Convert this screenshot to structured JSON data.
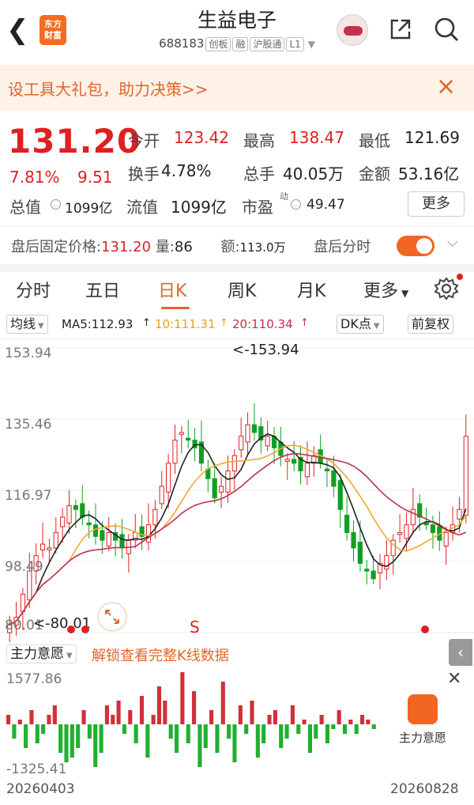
{
  "header": {
    "title": "生益电子",
    "code": "688183",
    "tags": [
      "创板",
      "融",
      "沪股通",
      "L1"
    ],
    "logo_text": "东方财富"
  },
  "banner": {
    "text": "设工具大礼包，助力决策>>",
    "close": "×"
  },
  "quote": {
    "price": "131.20",
    "change_pct": "7.81%",
    "change_amt": "9.51",
    "open_label": "今开",
    "open": "123.42",
    "high_label": "最高",
    "high": "138.47",
    "low_label": "最低",
    "low": "121.69",
    "turnover_label": "换手",
    "turnover": "4.78%",
    "volume_label": "总手",
    "volume": "40.05万",
    "amount_label": "金额",
    "amount": "53.16亿",
    "mcap_label": "总值",
    "mcap": "1099亿",
    "float_label": "流值",
    "float_cap": "1099亿",
    "pe_label": "市盈",
    "pe_super": "动",
    "pe": "49.47",
    "more_button": "更多"
  },
  "after_hours": {
    "price_label": "盘后固定价格:",
    "price": "131.20",
    "vol_label": "量:",
    "vol": "86",
    "amount_label": "额:",
    "amount": "113.0万",
    "timeshare_label": "盘后分时"
  },
  "tabs": [
    "分时",
    "五日",
    "日K",
    "周K",
    "月K",
    "更多"
  ],
  "active_tab": 2,
  "ma_row": {
    "type_chip": "均线",
    "ma5": "MA5:112.93",
    "ma10": "10:111.31",
    "ma20": "20:110.34",
    "dk_chip": "DK点",
    "adj_chip": "前复权"
  },
  "colors": {
    "up": "#e02020",
    "down": "#10a020",
    "ma5": "#222222",
    "ma10": "#f0a830",
    "ma20": "#c0304a",
    "accent": "#e2652a"
  },
  "chart_data": {
    "type": "candlestick",
    "y_ticks": [
      "153.94",
      "135.46",
      "116.97",
      "98.49",
      "80.01"
    ],
    "ylim": [
      80.01,
      153.94
    ],
    "annotations": {
      "max": "<-153.94",
      "min": "<-80.01",
      "signal": "S"
    },
    "closes": [
      82,
      84,
      90,
      96,
      100,
      103,
      102,
      106,
      110,
      113,
      112,
      110,
      108,
      105,
      104,
      106,
      104,
      102,
      104,
      106,
      105,
      108,
      112,
      118,
      124,
      130,
      132,
      130,
      128,
      124,
      120,
      115,
      118,
      122,
      126,
      131,
      134,
      132,
      130,
      131,
      128,
      126,
      125,
      124,
      122,
      124,
      126,
      124,
      122,
      118,
      112,
      106,
      102,
      98,
      96,
      94,
      98,
      100,
      104,
      106,
      108,
      112,
      110,
      108,
      106,
      104,
      106,
      108,
      112,
      131
    ]
  },
  "indicator": {
    "name": "主力意愿",
    "unlock_text": "解锁查看完整K线数据",
    "max_label": "1577.86",
    "min_label": "-1325.41",
    "card_label": "主力意愿",
    "bars": [
      2,
      -3,
      1,
      -5,
      3,
      -4,
      -2,
      2,
      4,
      -6,
      -8,
      -7,
      -5,
      3,
      -3,
      -9,
      -6,
      4,
      2,
      5,
      -2,
      3,
      -4,
      6,
      -7,
      2,
      8,
      5,
      -3,
      -6,
      11,
      -4,
      7,
      -9,
      -5,
      3,
      -6,
      9,
      -3,
      -8,
      4,
      -2,
      5,
      -7,
      -4,
      2,
      3,
      -5,
      -3,
      4,
      -2,
      1,
      -6,
      -3,
      2,
      -4,
      -1,
      3,
      -2,
      1,
      -2,
      2,
      1,
      -1
    ]
  },
  "dates": {
    "start": "20260403",
    "end": "20260828"
  }
}
